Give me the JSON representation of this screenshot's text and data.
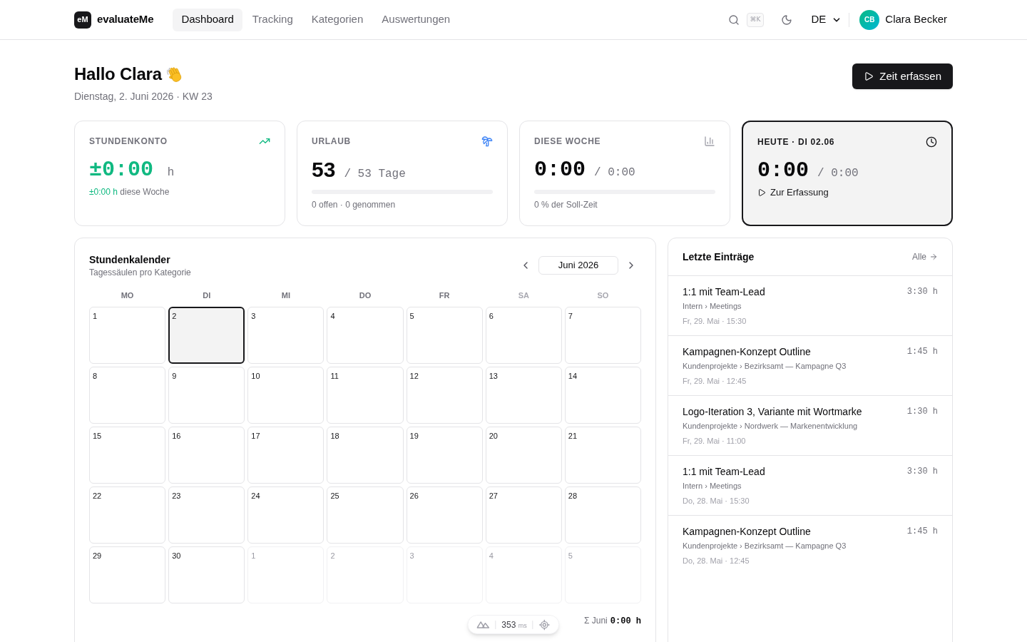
{
  "header": {
    "logo": {
      "mark": "eM",
      "name": "evaluateMe"
    },
    "nav": [
      {
        "label": "Dashboard",
        "selected": true
      },
      {
        "label": "Tracking",
        "selected": false
      },
      {
        "label": "Kategorien",
        "selected": false
      },
      {
        "label": "Auswertungen",
        "selected": false
      }
    ],
    "shortcut": "⌘K",
    "language": "DE",
    "user": {
      "initials": "CB",
      "name": "Clara Becker"
    }
  },
  "greeting": {
    "title": "Hallo Clara",
    "date": "Dienstag, 2. Juni 2026 · KW 23",
    "action": "Zeit erfassen"
  },
  "stats": [
    {
      "kind": "balance",
      "label": "STUNDENKONTO",
      "value": "±0:00",
      "unit": "h",
      "delta": "±0:00 h",
      "note": "diese Woche",
      "highlighted": false
    },
    {
      "kind": "vacation",
      "label": "URLAUB",
      "value": "53",
      "target": "/ 53 Tage",
      "level": 0,
      "note": "0 offen · 0 genommen",
      "highlighted": false
    },
    {
      "kind": "week",
      "label": "DIESE WOCHE",
      "value": "0:00",
      "target": "/ 0:00",
      "level": 0,
      "note": "0 % der Soll-Zeit",
      "highlighted": false
    },
    {
      "kind": "today",
      "label": "HEUTE · DI 02.06",
      "value": "0:00",
      "target": "/ 0:00",
      "link": "Zur Erfassung",
      "highlighted": true
    }
  ],
  "calendar": {
    "title": "Stundenkalender",
    "subtitle": "Tagessäulen pro Kategorie",
    "month": "Juni 2026",
    "weekdays": [
      {
        "label": "MO",
        "weekend": false
      },
      {
        "label": "DI",
        "weekend": false
      },
      {
        "label": "MI",
        "weekend": false
      },
      {
        "label": "DO",
        "weekend": false
      },
      {
        "label": "FR",
        "weekend": false
      },
      {
        "label": "SA",
        "weekend": true
      },
      {
        "label": "SO",
        "weekend": true
      }
    ],
    "days": [
      {
        "label": "1",
        "selected": false,
        "outside": false
      },
      {
        "label": "2",
        "selected": true,
        "outside": false
      },
      {
        "label": "3",
        "selected": false,
        "outside": false
      },
      {
        "label": "4",
        "selected": false,
        "outside": false
      },
      {
        "label": "5",
        "selected": false,
        "outside": false
      },
      {
        "label": "6",
        "selected": false,
        "outside": false
      },
      {
        "label": "7",
        "selected": false,
        "outside": false
      },
      {
        "label": "8",
        "selected": false,
        "outside": false
      },
      {
        "label": "9",
        "selected": false,
        "outside": false
      },
      {
        "label": "10",
        "selected": false,
        "outside": false
      },
      {
        "label": "11",
        "selected": false,
        "outside": false
      },
      {
        "label": "12",
        "selected": false,
        "outside": false
      },
      {
        "label": "13",
        "selected": false,
        "outside": false
      },
      {
        "label": "14",
        "selected": false,
        "outside": false
      },
      {
        "label": "15",
        "selected": false,
        "outside": false
      },
      {
        "label": "16",
        "selected": false,
        "outside": false
      },
      {
        "label": "17",
        "selected": false,
        "outside": false
      },
      {
        "label": "18",
        "selected": false,
        "outside": false
      },
      {
        "label": "19",
        "selected": false,
        "outside": false
      },
      {
        "label": "20",
        "selected": false,
        "outside": false
      },
      {
        "label": "21",
        "selected": false,
        "outside": false
      },
      {
        "label": "22",
        "selected": false,
        "outside": false
      },
      {
        "label": "23",
        "selected": false,
        "outside": false
      },
      {
        "label": "24",
        "selected": false,
        "outside": false
      },
      {
        "label": "25",
        "selected": false,
        "outside": false
      },
      {
        "label": "26",
        "selected": false,
        "outside": false
      },
      {
        "label": "27",
        "selected": false,
        "outside": false
      },
      {
        "label": "28",
        "selected": false,
        "outside": false
      },
      {
        "label": "29",
        "selected": false,
        "outside": false
      },
      {
        "label": "30",
        "selected": false,
        "outside": false
      },
      {
        "label": "1",
        "selected": false,
        "outside": true
      },
      {
        "label": "2",
        "selected": false,
        "outside": true
      },
      {
        "label": "3",
        "selected": false,
        "outside": true
      },
      {
        "label": "4",
        "selected": false,
        "outside": true
      },
      {
        "label": "5",
        "selected": false,
        "outside": true
      }
    ],
    "total_label": "Σ Juni",
    "total": "0:00 h"
  },
  "recent": {
    "title": "Letzte Einträge",
    "link": "Alle",
    "items": [
      {
        "title": "1:1 mit Team-Lead",
        "duration": "3:30 h",
        "category": "Intern › Meetings",
        "time": "Fr, 29. Mai · 15:30"
      },
      {
        "title": "Kampagnen-Konzept Outline",
        "duration": "1:45 h",
        "category": "Kundenprojekte › Bezirksamt — Kampagne Q3",
        "time": "Fr, 29. Mai · 12:45"
      },
      {
        "title": "Logo-Iteration 3, Variante mit Wortmarke",
        "duration": "1:30 h",
        "category": "Kundenprojekte › Nordwerk — Markenentwicklung",
        "time": "Fr, 29. Mai · 11:00"
      },
      {
        "title": "1:1 mit Team-Lead",
        "duration": "3:30 h",
        "category": "Intern › Meetings",
        "time": "Do, 28. Mai · 15:30"
      },
      {
        "title": "Kampagnen-Konzept Outline",
        "duration": "1:45 h",
        "category": "Kundenprojekte › Bezirksamt — Kampagne Q3",
        "time": "Do, 28. Mai · 12:45"
      }
    ]
  },
  "perf": {
    "value": "353",
    "unit": "ms"
  }
}
